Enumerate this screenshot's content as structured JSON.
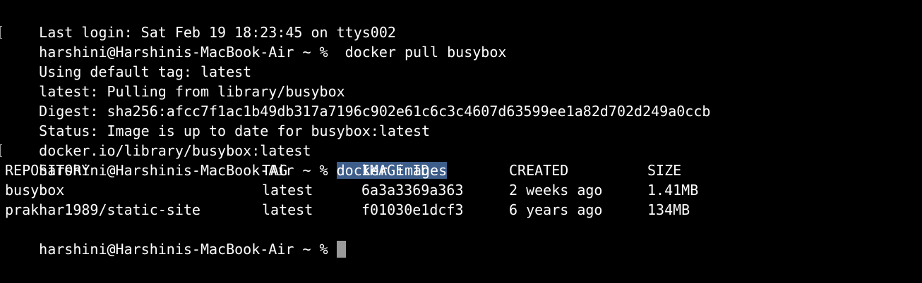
{
  "terminal": {
    "last_login": "Last login: Sat Feb 19 18:23:45 on ttys002",
    "prompt": "harshini@Harshinis-MacBook-Air ~ % ",
    "cmd_pull": " docker pull busybox",
    "pull_output": [
      "Using default tag: latest",
      "latest: Pulling from library/busybox",
      "Digest: sha256:afcc7f1ac1b49db317a7196c902e61c6c3c4607d63599ee1a82d702d249a0ccb",
      "Status: Image is up to date for busybox:latest",
      "docker.io/library/busybox:latest"
    ],
    "cmd_images": "docker images",
    "table": {
      "headers": [
        "REPOSITORY",
        "TAG",
        "IMAGE ID",
        "CREATED",
        "SIZE"
      ],
      "rows": [
        [
          "busybox",
          "latest",
          "6a3a3369a363",
          "2 weeks ago",
          "1.41MB"
        ],
        [
          "prakhar1989/static-site",
          "latest",
          "f01030e1dcf3",
          "6 years ago",
          "134MB"
        ]
      ]
    }
  },
  "colors": {
    "background": "#000000",
    "text": "#ffffff",
    "selection": "#3d5d8a",
    "cursor": "#9a9a9a"
  }
}
